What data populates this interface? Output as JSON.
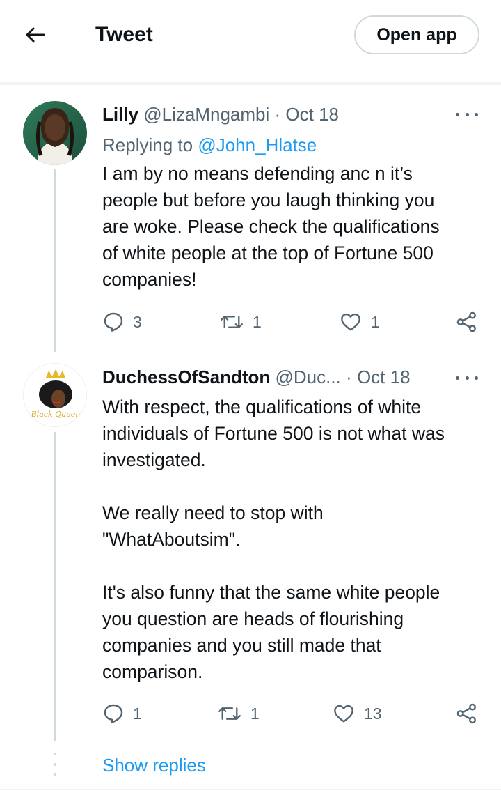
{
  "header": {
    "title": "Tweet",
    "open_app_label": "Open app"
  },
  "tweets": [
    {
      "name": "Lilly",
      "handle": "@LizaMngambi",
      "dot": "·",
      "date": "Oct 18",
      "replying_prefix": "Replying to",
      "replying_handle": "@John_Hlatse",
      "text": "I am by no means defending anc n it’s\npeople but before you laugh thinking you\nare woke. Please check the qualifications\nof white people at the top of Fortune 500\ncompanies!",
      "replies": "3",
      "retweets": "1",
      "likes": "1"
    },
    {
      "name": "DuchessOfSandton",
      "handle": "@Duc...",
      "dot": "·",
      "date": "Oct 18",
      "avatar_text": "Black Queen",
      "text": "With respect, the qualifications of white\nindividuals of Fortune 500 is not what was\ninvestigated.\n\nWe really need to stop with\n\"WhatAboutsim\".\n\nIt's also funny that the same white people\nyou question are heads of flourishing\ncompanies and you still made that\ncomparison.",
      "replies": "1",
      "retweets": "1",
      "likes": "13"
    }
  ],
  "show_replies_label": "Show replies",
  "colors": {
    "accent": "#1d9bf0",
    "muted": "#536471",
    "text": "#0f1419",
    "border": "#cfd9de"
  },
  "icons": [
    "back-arrow-icon",
    "more-icon",
    "reply-icon",
    "retweet-icon",
    "like-icon",
    "share-icon"
  ]
}
